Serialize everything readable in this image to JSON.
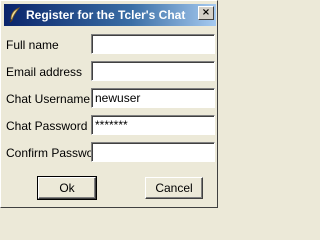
{
  "window": {
    "title": "Register for the Tcler's Chat",
    "close_glyph": "×"
  },
  "form": {
    "fields": [
      {
        "label": "Full name",
        "value": "",
        "type": "text"
      },
      {
        "label": "Email address",
        "value": "",
        "type": "text"
      },
      {
        "label": "Chat Username",
        "value": "newuser",
        "type": "text"
      },
      {
        "label": "Chat Password",
        "value": "*******",
        "type": "password"
      },
      {
        "label": "Confirm Password",
        "value": "",
        "type": "password"
      }
    ]
  },
  "buttons": {
    "ok_label": "Ok",
    "cancel_label": "Cancel"
  },
  "icons": {
    "title_icon": "feather-icon"
  }
}
